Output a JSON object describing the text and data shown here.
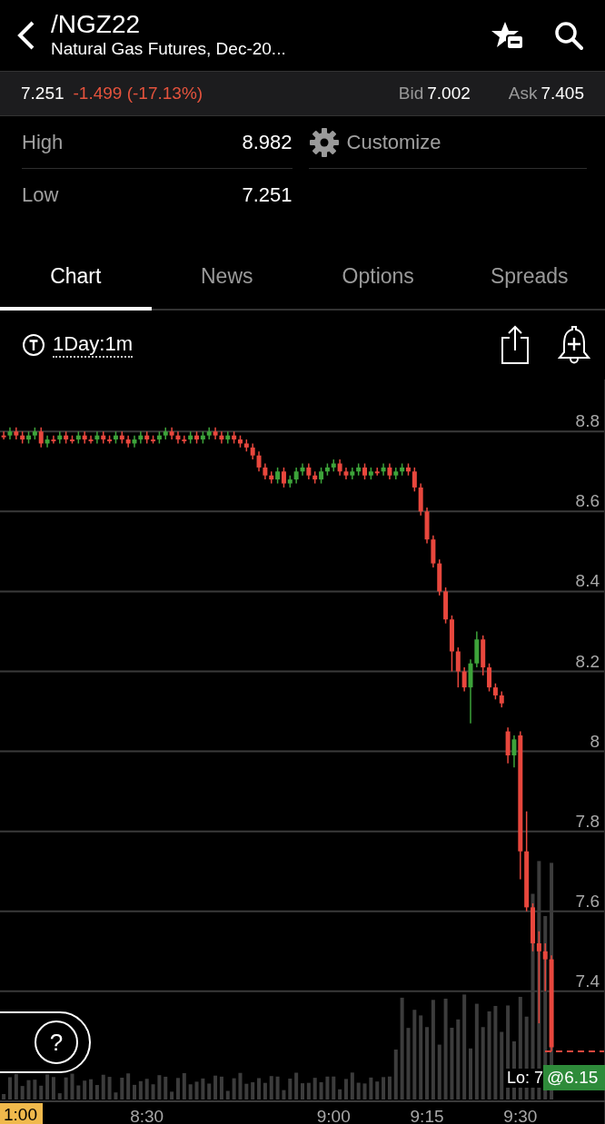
{
  "header": {
    "symbol": "/NGZ22",
    "description": "Natural Gas Futures, Dec-20..."
  },
  "quote": {
    "last": "7.251",
    "change": "-1.499 (-17.13%)",
    "bid_label": "Bid",
    "bid": "7.002",
    "ask_label": "Ask",
    "ask": "7.405"
  },
  "stats": [
    {
      "label": "High",
      "value": "8.982"
    },
    {
      "label": "Low",
      "value": "7.251"
    }
  ],
  "customize": {
    "label": "Customize"
  },
  "tabs": [
    {
      "label": "Chart",
      "selected": true
    },
    {
      "label": "News",
      "selected": false
    },
    {
      "label": "Options",
      "selected": false
    },
    {
      "label": "Spreads",
      "selected": false
    }
  ],
  "chart_toolbar": {
    "timeframe": "1Day:1m"
  },
  "chart": {
    "crosshair_time": "1:00",
    "low_label": "Lo: 7",
    "last_price_tag": "@6.15",
    "chart_data": {
      "type": "candlestick",
      "x": [
        487,
        488,
        489,
        490,
        491,
        492,
        493,
        494,
        495,
        496,
        497,
        498,
        499,
        500,
        501,
        502,
        503,
        504,
        505,
        506,
        507,
        508,
        509,
        510,
        511,
        512,
        513,
        514,
        515,
        516,
        517,
        518,
        519,
        520,
        521,
        522,
        523,
        524,
        525,
        526,
        527,
        528,
        529,
        530,
        531,
        532,
        533,
        534,
        535,
        536,
        537,
        538,
        539,
        540,
        541,
        542,
        543,
        544,
        545,
        546,
        547,
        548,
        549,
        550,
        551,
        552,
        553,
        554,
        555,
        556,
        557,
        558,
        559,
        560,
        561,
        562,
        563,
        564,
        565,
        566,
        567,
        568,
        569,
        570,
        571,
        572,
        573,
        574,
        575
      ],
      "ohlc": [
        [
          8.79,
          8.8,
          8.78,
          8.79
        ],
        [
          8.79,
          8.81,
          8.78,
          8.8
        ],
        [
          8.8,
          8.81,
          8.78,
          8.79
        ],
        [
          8.79,
          8.8,
          8.77,
          8.78
        ],
        [
          8.78,
          8.8,
          8.77,
          8.79
        ],
        [
          8.79,
          8.81,
          8.78,
          8.8
        ],
        [
          8.8,
          8.81,
          8.76,
          8.77
        ],
        [
          8.77,
          8.79,
          8.76,
          8.78
        ],
        [
          8.78,
          8.79,
          8.77,
          8.78
        ],
        [
          8.78,
          8.8,
          8.77,
          8.79
        ],
        [
          8.79,
          8.8,
          8.77,
          8.78
        ],
        [
          8.78,
          8.79,
          8.77,
          8.78
        ],
        [
          8.78,
          8.8,
          8.77,
          8.79
        ],
        [
          8.79,
          8.8,
          8.77,
          8.78
        ],
        [
          8.78,
          8.79,
          8.77,
          8.78
        ],
        [
          8.78,
          8.8,
          8.77,
          8.79
        ],
        [
          8.79,
          8.8,
          8.77,
          8.78
        ],
        [
          8.78,
          8.79,
          8.77,
          8.78
        ],
        [
          8.78,
          8.8,
          8.77,
          8.79
        ],
        [
          8.79,
          8.8,
          8.77,
          8.78
        ],
        [
          8.78,
          8.79,
          8.76,
          8.77
        ],
        [
          8.77,
          8.79,
          8.76,
          8.78
        ],
        [
          8.78,
          8.8,
          8.77,
          8.79
        ],
        [
          8.79,
          8.8,
          8.77,
          8.78
        ],
        [
          8.78,
          8.79,
          8.77,
          8.78
        ],
        [
          8.78,
          8.8,
          8.77,
          8.79
        ],
        [
          8.79,
          8.81,
          8.78,
          8.8
        ],
        [
          8.8,
          8.81,
          8.78,
          8.79
        ],
        [
          8.79,
          8.8,
          8.77,
          8.78
        ],
        [
          8.78,
          8.79,
          8.77,
          8.78
        ],
        [
          8.78,
          8.8,
          8.77,
          8.79
        ],
        [
          8.79,
          8.8,
          8.77,
          8.78
        ],
        [
          8.78,
          8.8,
          8.77,
          8.79
        ],
        [
          8.79,
          8.81,
          8.78,
          8.8
        ],
        [
          8.8,
          8.81,
          8.78,
          8.79
        ],
        [
          8.79,
          8.8,
          8.77,
          8.78
        ],
        [
          8.78,
          8.8,
          8.77,
          8.79
        ],
        [
          8.79,
          8.8,
          8.77,
          8.78
        ],
        [
          8.78,
          8.79,
          8.76,
          8.77
        ],
        [
          8.77,
          8.78,
          8.75,
          8.76
        ],
        [
          8.76,
          8.77,
          8.73,
          8.74
        ],
        [
          8.74,
          8.75,
          8.7,
          8.71
        ],
        [
          8.71,
          8.72,
          8.68,
          8.69
        ],
        [
          8.69,
          8.7,
          8.67,
          8.68
        ],
        [
          8.68,
          8.71,
          8.67,
          8.7
        ],
        [
          8.7,
          8.71,
          8.66,
          8.67
        ],
        [
          8.67,
          8.69,
          8.66,
          8.68
        ],
        [
          8.68,
          8.71,
          8.67,
          8.7
        ],
        [
          8.7,
          8.72,
          8.69,
          8.71
        ],
        [
          8.71,
          8.72,
          8.68,
          8.69
        ],
        [
          8.69,
          8.7,
          8.67,
          8.68
        ],
        [
          8.68,
          8.71,
          8.67,
          8.7
        ],
        [
          8.7,
          8.72,
          8.69,
          8.71
        ],
        [
          8.71,
          8.73,
          8.7,
          8.72
        ],
        [
          8.72,
          8.73,
          8.69,
          8.7
        ],
        [
          8.7,
          8.71,
          8.68,
          8.69
        ],
        [
          8.69,
          8.71,
          8.68,
          8.7
        ],
        [
          8.7,
          8.72,
          8.69,
          8.71
        ],
        [
          8.71,
          8.72,
          8.68,
          8.69
        ],
        [
          8.69,
          8.71,
          8.68,
          8.7
        ],
        [
          8.7,
          8.71,
          8.69,
          8.7
        ],
        [
          8.7,
          8.72,
          8.69,
          8.71
        ],
        [
          8.71,
          8.72,
          8.68,
          8.69
        ],
        [
          8.69,
          8.71,
          8.68,
          8.7
        ],
        [
          8.7,
          8.72,
          8.69,
          8.71
        ],
        [
          8.71,
          8.72,
          8.69,
          8.7
        ],
        [
          8.7,
          8.71,
          8.65,
          8.66
        ],
        [
          8.66,
          8.67,
          8.59,
          8.6
        ],
        [
          8.6,
          8.61,
          8.52,
          8.53
        ],
        [
          8.53,
          8.54,
          8.46,
          8.47
        ],
        [
          8.47,
          8.48,
          8.39,
          8.4
        ],
        [
          8.4,
          8.41,
          8.32,
          8.33
        ],
        [
          8.33,
          8.34,
          8.2,
          8.25
        ],
        [
          8.25,
          8.26,
          8.16,
          8.2
        ],
        [
          8.2,
          8.21,
          8.15,
          8.16
        ],
        [
          8.16,
          8.23,
          8.07,
          8.22
        ],
        [
          8.22,
          8.3,
          8.21,
          8.28
        ],
        [
          8.28,
          8.29,
          8.19,
          8.21
        ],
        [
          8.21,
          8.22,
          8.15,
          8.16
        ],
        [
          8.16,
          8.17,
          8.13,
          8.14
        ],
        [
          8.14,
          8.15,
          8.11,
          8.12
        ],
        [
          8.05,
          8.06,
          7.97,
          7.99
        ],
        [
          7.99,
          8.04,
          7.96,
          8.03
        ],
        [
          8.04,
          8.05,
          7.68,
          7.75
        ],
        [
          7.75,
          7.85,
          7.6,
          7.61
        ],
        [
          7.61,
          7.62,
          7.5,
          7.52
        ],
        [
          7.52,
          7.55,
          7.32,
          7.5
        ],
        [
          7.5,
          7.52,
          7.4,
          7.48
        ],
        [
          7.48,
          7.49,
          7.25,
          7.26
        ]
      ],
      "xlim": [
        486.4,
        583.6
      ],
      "grid": true,
      "ylim": [
        7.05,
        8.93
      ],
      "yticks": [
        8.8,
        8.6,
        8.4,
        8.2,
        8,
        7.8,
        7.6,
        7.4
      ],
      "xticks": [
        {
          "value": 510,
          "label": "8:30"
        },
        {
          "value": 540,
          "label": "9:00"
        },
        {
          "value": 555,
          "label": "9:15"
        },
        {
          "value": 570,
          "label": "9:30"
        }
      ]
    }
  },
  "help_button": {
    "label": "?"
  }
}
